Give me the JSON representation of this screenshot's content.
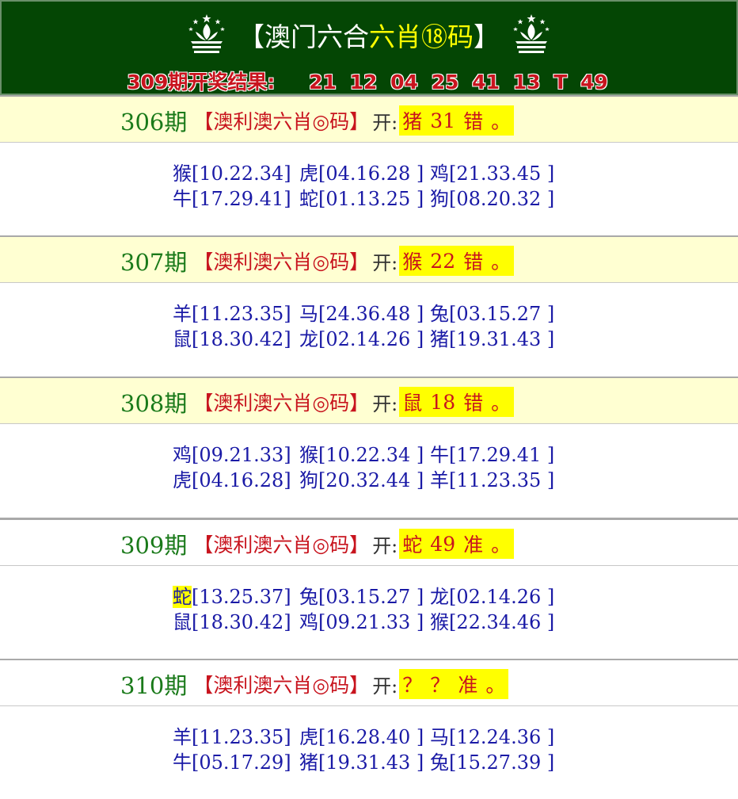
{
  "header": {
    "title_left": "【澳门六合",
    "title_yellow": "六肖⑱码",
    "title_right": "】",
    "result_label": "309期开奖结果:",
    "result_numbers": [
      "21",
      "12",
      "04",
      "25",
      "41",
      "13",
      "T",
      "49"
    ]
  },
  "sections": [
    {
      "issue": "306期",
      "brand": "【澳利澳六肖◎码】",
      "open_label": "开:",
      "hl": [
        "猪",
        "31",
        "错",
        "。"
      ],
      "rows": [
        [
          {
            "z": "猴",
            "n": "[10.22.34]"
          },
          {
            "z": "虎",
            "n": "[04.16.28 ]"
          },
          {
            "z": "鸡",
            "n": "[21.33.45 ]"
          }
        ],
        [
          {
            "z": "牛",
            "n": "[17.29.41]"
          },
          {
            "z": "蛇",
            "n": "[01.13.25 ]"
          },
          {
            "z": "狗",
            "n": "[08.20.32 ]"
          }
        ]
      ]
    },
    {
      "issue": "307期",
      "brand": "【澳利澳六肖◎码】",
      "open_label": "开:",
      "hl": [
        "猴",
        "22",
        "错",
        "。"
      ],
      "rows": [
        [
          {
            "z": "羊",
            "n": "[11.23.35]"
          },
          {
            "z": "马",
            "n": "[24.36.48 ]"
          },
          {
            "z": "兔",
            "n": "[03.15.27 ]"
          }
        ],
        [
          {
            "z": "鼠",
            "n": "[18.30.42]"
          },
          {
            "z": "龙",
            "n": "[02.14.26 ]"
          },
          {
            "z": "猪",
            "n": "[19.31.43 ]"
          }
        ]
      ]
    },
    {
      "issue": "308期",
      "brand": "【澳利澳六肖◎码】",
      "open_label": "开:",
      "hl": [
        "鼠",
        "18",
        "错",
        "。"
      ],
      "rows": [
        [
          {
            "z": "鸡",
            "n": "[09.21.33]"
          },
          {
            "z": "猴",
            "n": "[10.22.34 ]"
          },
          {
            "z": "牛",
            "n": "[17.29.41 ]"
          }
        ],
        [
          {
            "z": "虎",
            "n": "[04.16.28]"
          },
          {
            "z": "狗",
            "n": "[20.32.44 ]"
          },
          {
            "z": "羊",
            "n": "[11.23.35 ]"
          }
        ]
      ]
    },
    {
      "issue": "309期",
      "brand": "【澳利澳六肖◎码】",
      "open_label": "开:",
      "hl": [
        "蛇",
        "49",
        "准",
        "。"
      ],
      "rows": [
        [
          {
            "z": "蛇",
            "n": "[13.25.37]",
            "mark": true
          },
          {
            "z": "兔",
            "n": "[03.15.27 ]"
          },
          {
            "z": "龙",
            "n": "[02.14.26 ]"
          }
        ],
        [
          {
            "z": "鼠",
            "n": "[18.30.42]"
          },
          {
            "z": "鸡",
            "n": "[09.21.33 ]"
          },
          {
            "z": "猴",
            "n": "[22.34.46 ]"
          }
        ]
      ]
    },
    {
      "issue": "310期",
      "brand": "【澳利澳六肖◎码】",
      "open_label": "开:",
      "hl": [
        "？",
        "？",
        "准",
        "。"
      ],
      "rows": [
        [
          {
            "z": "羊",
            "n": "[11.23.35]"
          },
          {
            "z": "虎",
            "n": "[16.28.40 ]"
          },
          {
            "z": "马",
            "n": "[12.24.36 ]"
          }
        ],
        [
          {
            "z": "牛",
            "n": "[05.17.29]"
          },
          {
            "z": "猪",
            "n": "[19.31.43 ]"
          },
          {
            "z": "兔",
            "n": "[15.27.39 ]"
          }
        ]
      ]
    }
  ]
}
